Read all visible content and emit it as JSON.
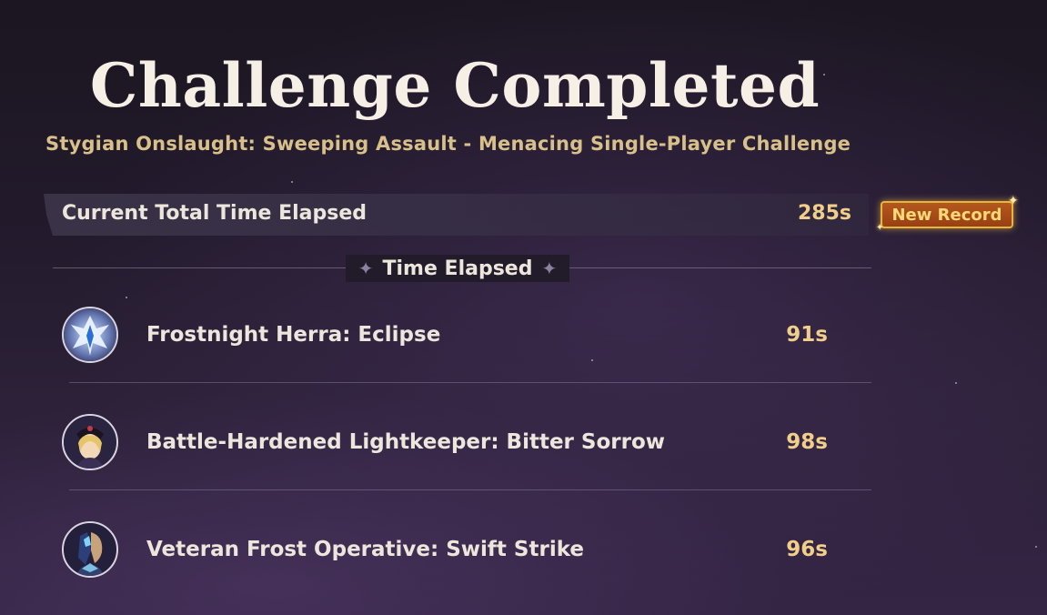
{
  "header": {
    "title": "Challenge Completed",
    "subtitle": "Stygian Onslaught: Sweeping Assault - Menacing Single-Player Challenge"
  },
  "total": {
    "label": "Current Total Time Elapsed",
    "value": "285s",
    "badge": "New Record"
  },
  "section": {
    "label": "Time Elapsed"
  },
  "entries": [
    {
      "name": "Frostnight Herra: Eclipse",
      "time": "91s",
      "icon": "frostnight-herra-icon"
    },
    {
      "name": "Battle-Hardened Lightkeeper: Bitter Sorrow",
      "time": "98s",
      "icon": "lightkeeper-icon"
    },
    {
      "name": "Veteran Frost Operative: Swift Strike",
      "time": "96s",
      "icon": "frost-operative-icon"
    }
  ],
  "colors": {
    "title": "#f6efe6",
    "subtitle": "#d8c08a",
    "time": "#f1cf8a",
    "badge_border": "#e8b53c",
    "badge_fill": "#a8491a",
    "background": "#241b2e"
  }
}
